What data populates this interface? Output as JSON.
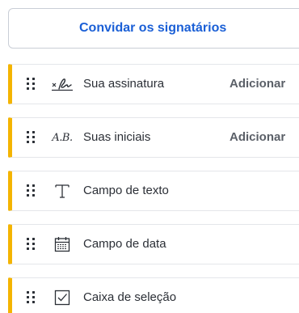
{
  "invite_button": {
    "label": "Convidar os signatários"
  },
  "fields": [
    {
      "icon": "signature-icon",
      "label": "Sua assinatura",
      "action": "Adicionar"
    },
    {
      "icon": "initials-icon",
      "label": "Suas iniciais",
      "action": "Adicionar",
      "icon_text": "A.B."
    },
    {
      "icon": "text-field-icon",
      "label": "Campo de texto"
    },
    {
      "icon": "calendar-icon",
      "label": "Campo de data"
    },
    {
      "icon": "checkbox-icon",
      "label": "Caixa de seleção"
    }
  ],
  "colors": {
    "accent_bar": "#f4b400",
    "link_blue": "#1a5fd6",
    "text_dark": "#2b2f36",
    "action_gray": "#5b6068"
  }
}
